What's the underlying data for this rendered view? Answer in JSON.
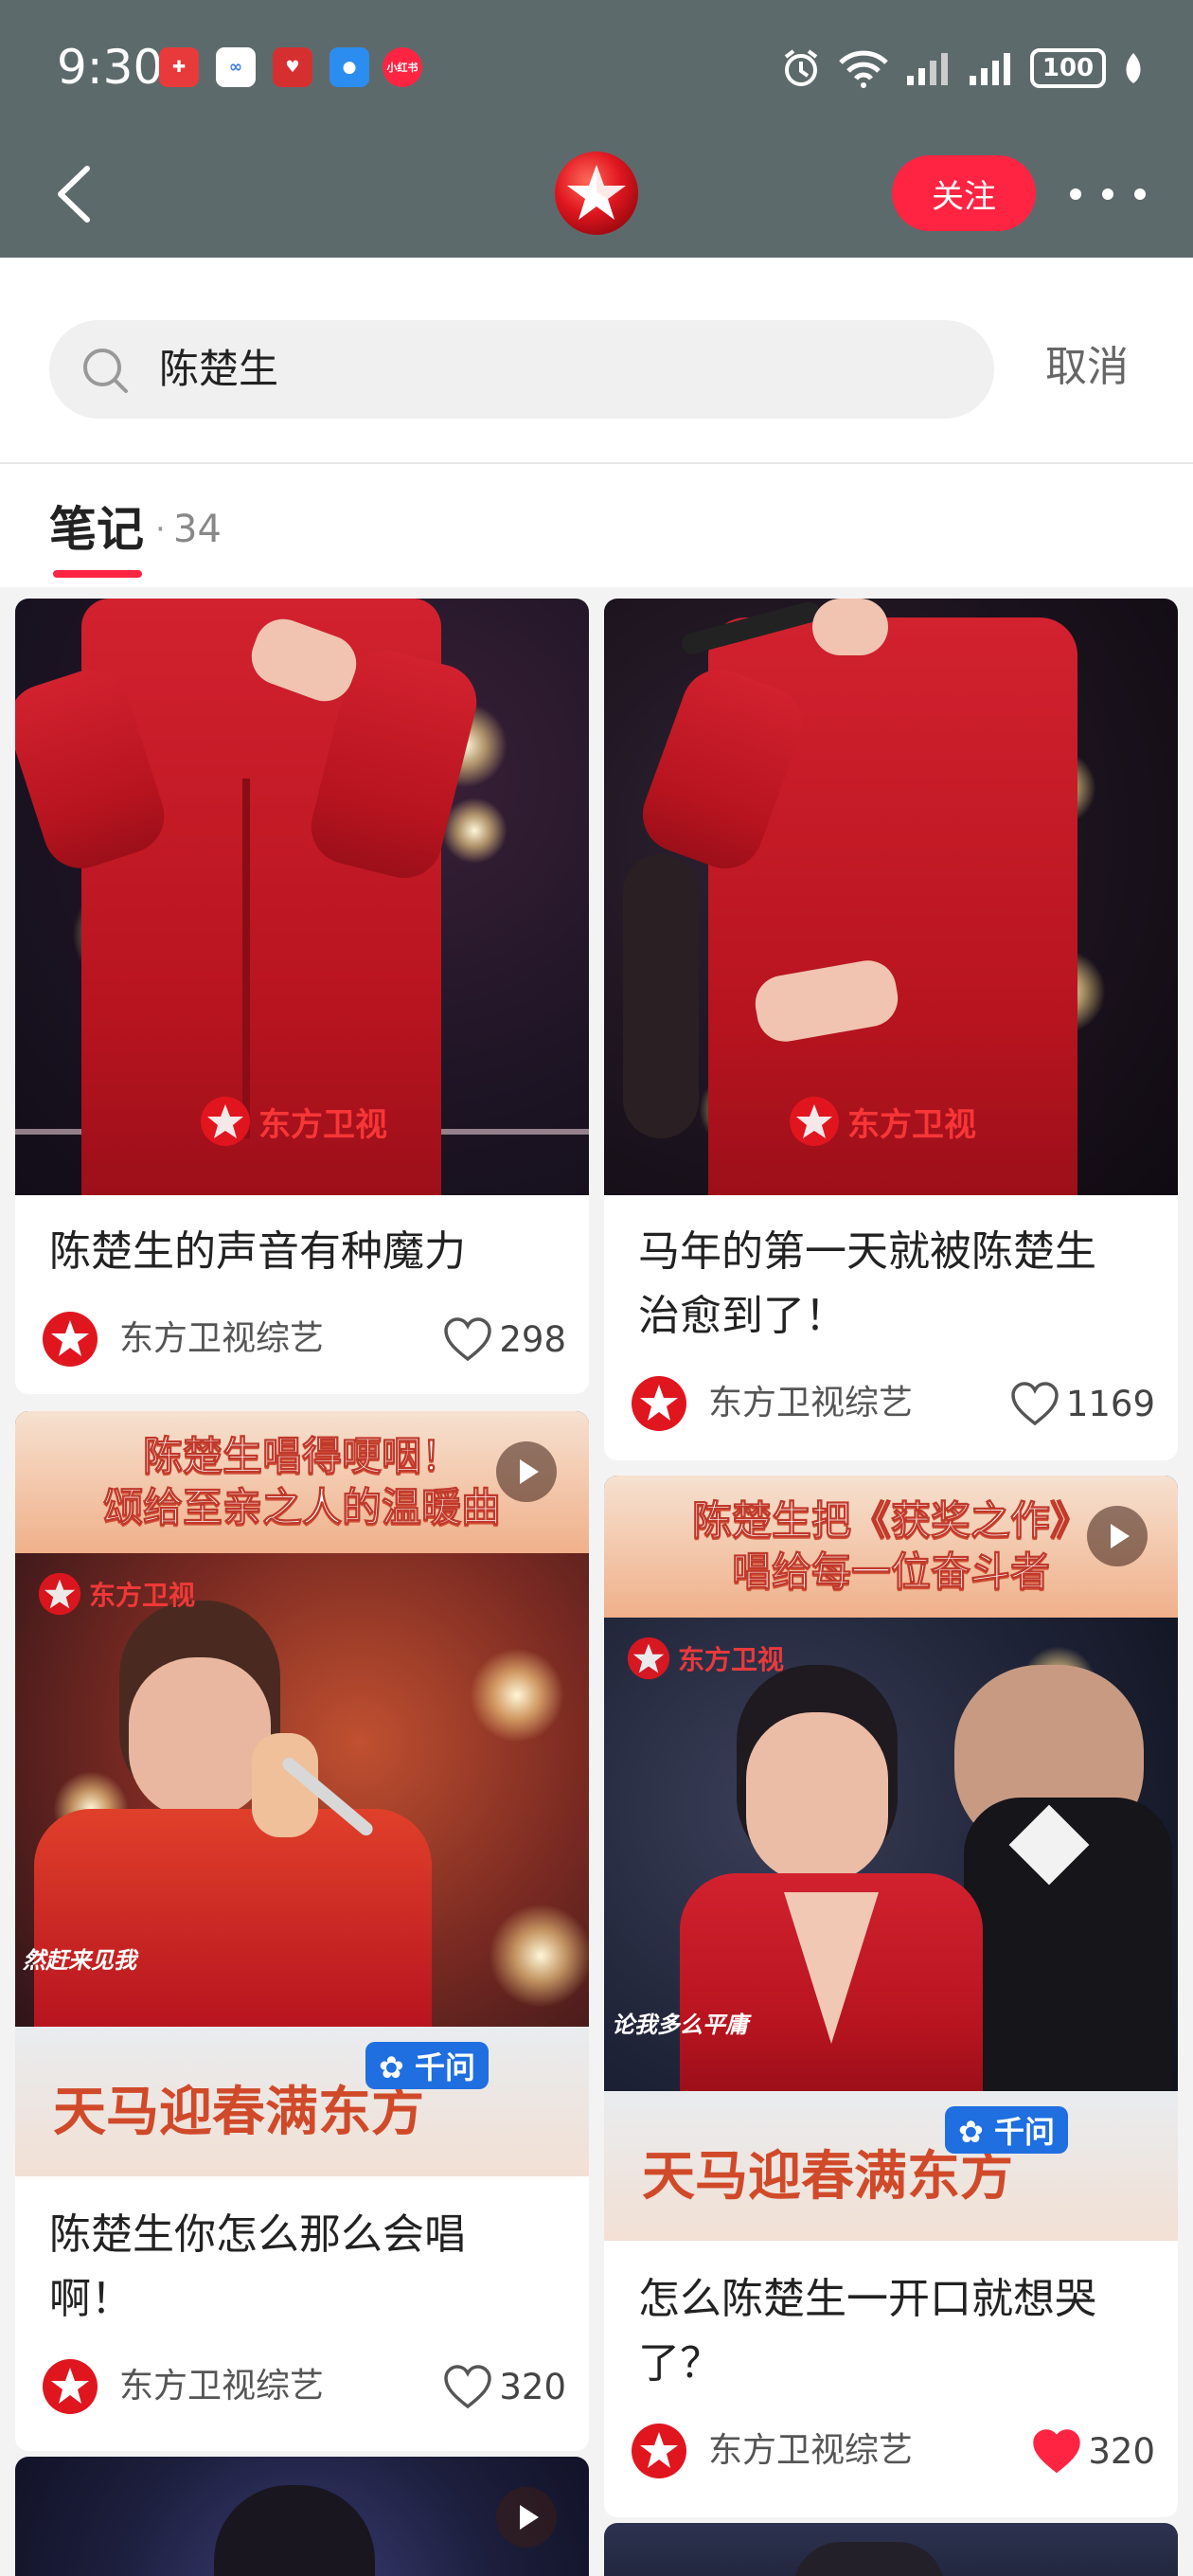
{
  "status_bar": {
    "time": "9:30",
    "battery": "100",
    "icons": [
      "alarm-icon",
      "wifi-icon",
      "signal-icon",
      "signal-icon",
      "battery-icon",
      "leaf-icon"
    ],
    "app_badge_text": "小红书"
  },
  "nav": {
    "follow_label": "关注",
    "logo_icon": "dragon-tv-logo-icon"
  },
  "search": {
    "query": "陈楚生",
    "cancel_label": "取消"
  },
  "tab": {
    "label": "笔记",
    "dot": "·",
    "count": "34"
  },
  "cards": [
    {
      "title_lines": [
        "陈楚生的声音有种魔力"
      ],
      "author": "东方卫视综艺",
      "likes": "298",
      "liked": false,
      "watermark": "东方卫视"
    },
    {
      "title_lines": [
        "马年的第一天就被陈楚生",
        "治愈到了！"
      ],
      "author": "东方卫视综艺",
      "likes": "1169",
      "liked": false,
      "watermark": "东方卫视"
    },
    {
      "banner_lines": [
        "陈楚生唱得哽咽！",
        "颂给至亲之人的温暖曲"
      ],
      "title_lines": [
        "陈楚生你怎么那么会唱",
        "啊！"
      ],
      "author": "东方卫视综艺",
      "likes": "320",
      "liked": false,
      "watermark": "东方卫视",
      "lyric": "然赶来见我",
      "festival": "天马迎春满东方",
      "qianwen": "千问"
    },
    {
      "banner_lines": [
        "陈楚生把《获奖之作》",
        "唱给每一位奋斗者"
      ],
      "title_lines": [
        "怎么陈楚生一开口就想哭",
        "了？"
      ],
      "author": "东方卫视综艺",
      "likes": "320",
      "liked": true,
      "watermark": "东方卫视",
      "lyric": "论我多么平庸",
      "festival": "天马迎春满东方",
      "qianwen": "千问"
    }
  ],
  "colors": {
    "header_bg": "#5d6a6c",
    "accent": "#ff2442",
    "page_bg": "#f3f3f3"
  }
}
